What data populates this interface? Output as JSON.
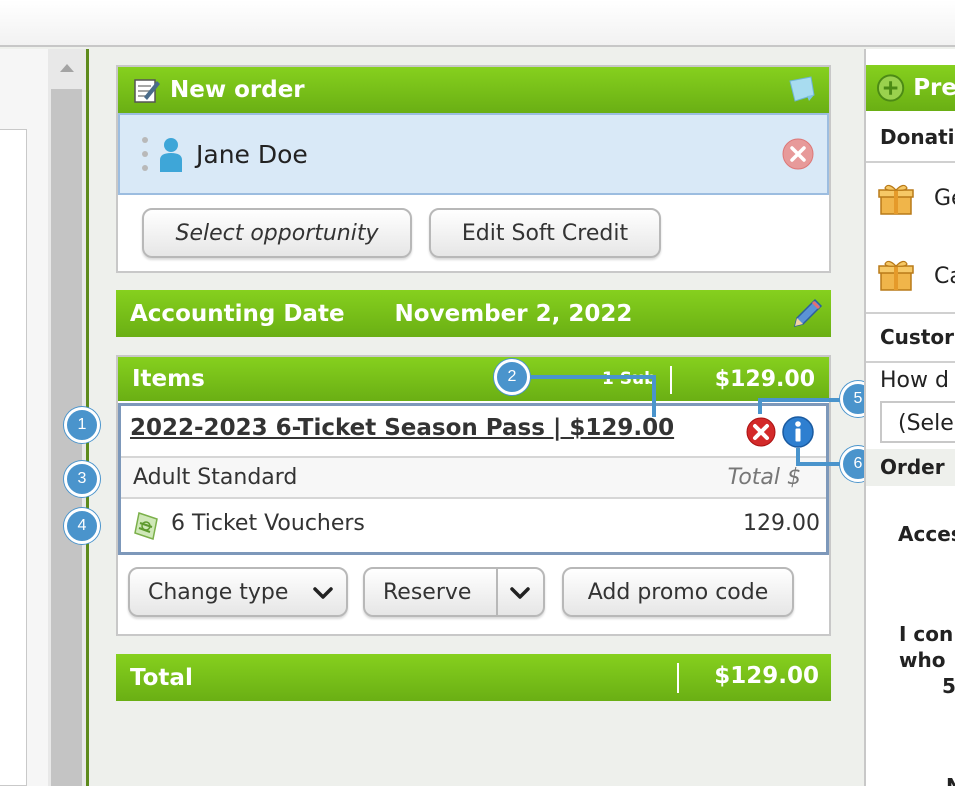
{
  "new_order": {
    "title": "New order",
    "customer_name": "Jane Doe",
    "select_opportunity_label": "Select opportunity",
    "edit_soft_credit_label": "Edit Soft Credit"
  },
  "accounting": {
    "label": "Accounting Date",
    "date": "November 2, 2022"
  },
  "items": {
    "title": "Items",
    "sub_count": "1 Sub",
    "total": "$129.00",
    "product_title": "2022-2023 6-Ticket Season Pass | $129.00",
    "price_type": "Adult Standard",
    "total_col_label": "Total $",
    "voucher_label": "6 Ticket Vouchers",
    "voucher_amount": "129.00",
    "change_type_label": "Change type",
    "reserve_label": "Reserve",
    "promo_label": "Add promo code"
  },
  "total_bar": {
    "label": "Total",
    "amount": "$129.00"
  },
  "callouts": [
    "1",
    "2",
    "3",
    "4",
    "5",
    "6"
  ],
  "right_pane": {
    "header": "Pre",
    "donations_label": "Donati",
    "gift1": "Ge",
    "gift2": "Ca",
    "custom_label": "Custor",
    "how_label": "How d",
    "select_value": "(Sele",
    "order_label": "Order",
    "access_label": "Acces",
    "i_con": "I con",
    "who": "who",
    "five": "5",
    "n": "N"
  }
}
